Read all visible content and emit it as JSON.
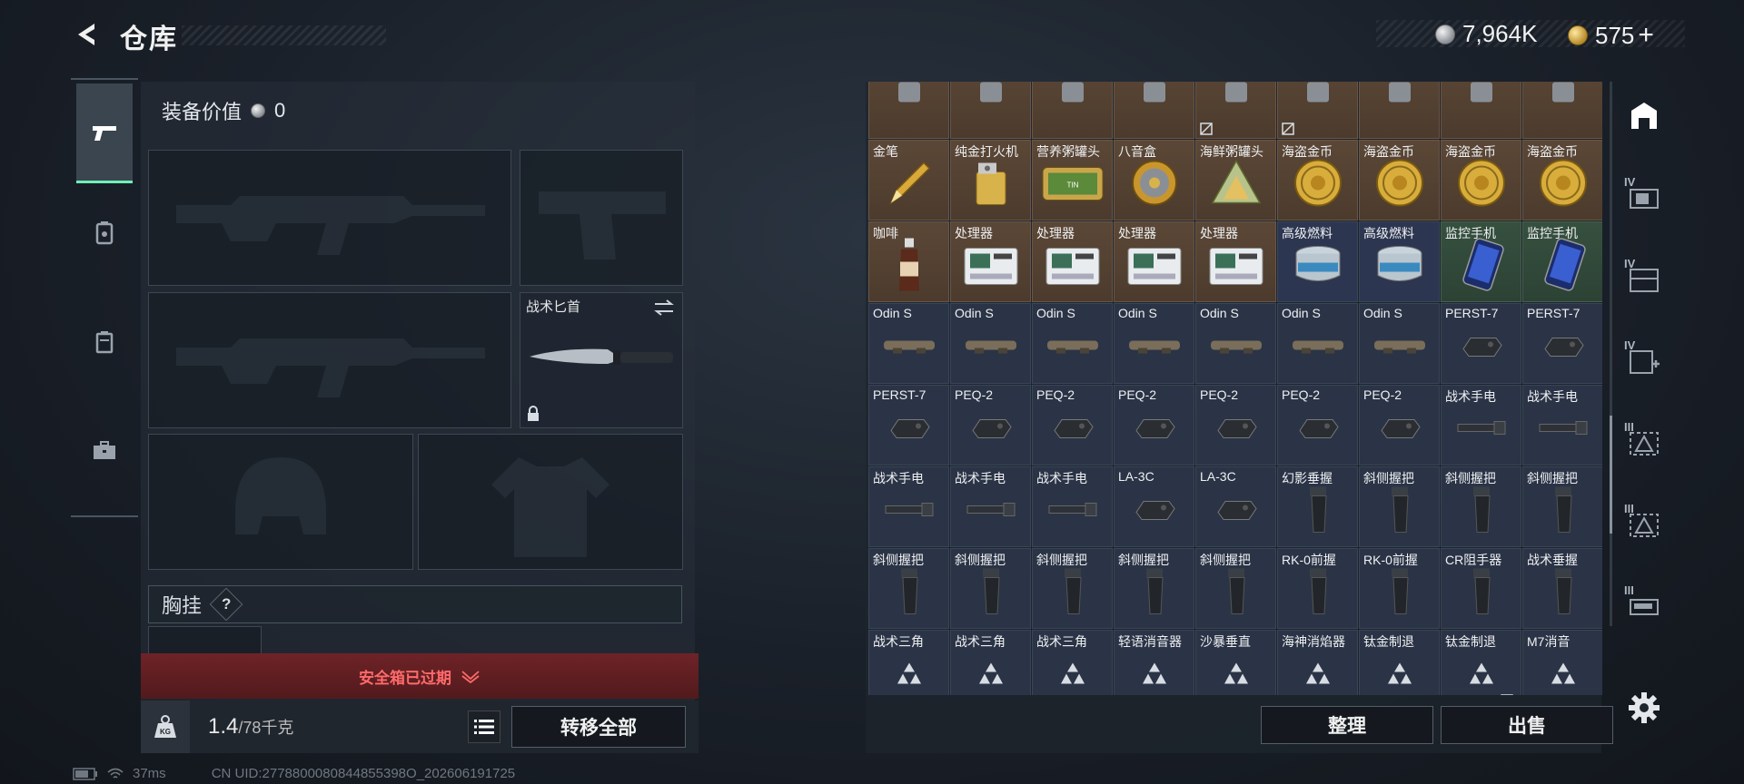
{
  "header": {
    "title": "仓库",
    "currencies": [
      {
        "type": "silver",
        "value": "7,964K"
      },
      {
        "type": "gold",
        "value": "575"
      }
    ],
    "gold_add_label": "+"
  },
  "left_nav": [
    "weapon-tab",
    "armor-tab",
    "backpack-tab",
    "case-tab"
  ],
  "equipment": {
    "value_label": "装备价值",
    "value": "0",
    "melee_label": "战术匕首",
    "vest_label": "胸挂",
    "help_glyph": "?",
    "safebox_expired": "安全箱已过期",
    "weight_current": "1.4",
    "weight_max": "/78千克",
    "kg_label": "KG",
    "transfer_all": "转移全部"
  },
  "status": {
    "ping": "37ms",
    "uid": "CN UID:2778800080844855398O_202606191725"
  },
  "items": [
    {
      "name": "金笔",
      "bg": "brown",
      "icon": "pen"
    },
    {
      "name": "纯金打火机",
      "bg": "brown",
      "icon": "lighter"
    },
    {
      "name": "营养粥罐头",
      "bg": "brown",
      "icon": "tin"
    },
    {
      "name": "八音盒",
      "bg": "brown",
      "icon": "musicbox"
    },
    {
      "name": "海鲜粥罐头",
      "bg": "brown",
      "icon": "pyramid-can"
    },
    {
      "name": "海盗金币",
      "bg": "brown",
      "icon": "coin"
    },
    {
      "name": "海盗金币",
      "bg": "brown",
      "icon": "coin"
    },
    {
      "name": "海盗金币",
      "bg": "brown",
      "icon": "coin"
    },
    {
      "name": "海盗金币",
      "bg": "brown",
      "icon": "coin"
    },
    {
      "name": "咖啡",
      "bg": "brown",
      "icon": "bottle"
    },
    {
      "name": "处理器",
      "bg": "brown",
      "icon": "processor"
    },
    {
      "name": "处理器",
      "bg": "brown",
      "icon": "processor"
    },
    {
      "name": "处理器",
      "bg": "brown",
      "icon": "processor"
    },
    {
      "name": "处理器",
      "bg": "brown",
      "icon": "processor"
    },
    {
      "name": "高级燃料",
      "bg": "blue",
      "icon": "fuel"
    },
    {
      "name": "高级燃料",
      "bg": "blue",
      "icon": "fuel"
    },
    {
      "name": "监控手机",
      "bg": "green",
      "icon": "phone"
    },
    {
      "name": "监控手机",
      "bg": "green",
      "icon": "phone"
    },
    {
      "name": "Odin S",
      "bg": "",
      "icon": "scope"
    },
    {
      "name": "Odin S",
      "bg": "",
      "icon": "scope"
    },
    {
      "name": "Odin S",
      "bg": "",
      "icon": "scope"
    },
    {
      "name": "Odin S",
      "bg": "",
      "icon": "scope"
    },
    {
      "name": "Odin S",
      "bg": "",
      "icon": "scope"
    },
    {
      "name": "Odin S",
      "bg": "",
      "icon": "scope"
    },
    {
      "name": "Odin S",
      "bg": "",
      "icon": "scope"
    },
    {
      "name": "PERST-7",
      "bg": "",
      "icon": "laser"
    },
    {
      "name": "PERST-7",
      "bg": "",
      "icon": "laser"
    },
    {
      "name": "PERST-7",
      "bg": "",
      "icon": "laser"
    },
    {
      "name": "PEQ-2",
      "bg": "",
      "icon": "laser"
    },
    {
      "name": "PEQ-2",
      "bg": "",
      "icon": "laser"
    },
    {
      "name": "PEQ-2",
      "bg": "",
      "icon": "laser"
    },
    {
      "name": "PEQ-2",
      "bg": "",
      "icon": "laser"
    },
    {
      "name": "PEQ-2",
      "bg": "",
      "icon": "laser"
    },
    {
      "name": "PEQ-2",
      "bg": "",
      "icon": "laser"
    },
    {
      "name": "战术手电",
      "bg": "",
      "icon": "flashlight"
    },
    {
      "name": "战术手电",
      "bg": "",
      "icon": "flashlight"
    },
    {
      "name": "战术手电",
      "bg": "",
      "icon": "flashlight"
    },
    {
      "name": "战术手电",
      "bg": "",
      "icon": "flashlight"
    },
    {
      "name": "战术手电",
      "bg": "",
      "icon": "flashlight"
    },
    {
      "name": "LA-3C",
      "bg": "",
      "icon": "laser"
    },
    {
      "name": "LA-3C",
      "bg": "",
      "icon": "laser"
    },
    {
      "name": "幻影垂握",
      "bg": "",
      "icon": "grip"
    },
    {
      "name": "斜侧握把",
      "bg": "",
      "icon": "grip"
    },
    {
      "name": "斜侧握把",
      "bg": "",
      "icon": "grip"
    },
    {
      "name": "斜侧握把",
      "bg": "",
      "icon": "grip"
    },
    {
      "name": "斜侧握把",
      "bg": "",
      "icon": "grip"
    },
    {
      "name": "斜侧握把",
      "bg": "",
      "icon": "grip"
    },
    {
      "name": "斜侧握把",
      "bg": "",
      "icon": "grip"
    },
    {
      "name": "斜侧握把",
      "bg": "",
      "icon": "grip"
    },
    {
      "name": "斜侧握把",
      "bg": "",
      "icon": "grip"
    },
    {
      "name": "RK-0前握",
      "bg": "",
      "icon": "grip"
    },
    {
      "name": "RK-0前握",
      "bg": "",
      "icon": "grip"
    },
    {
      "name": "CR阻手器",
      "bg": "",
      "icon": "grip"
    },
    {
      "name": "战术垂握",
      "bg": "",
      "icon": "grip"
    },
    {
      "name": "战术三角",
      "bg": "",
      "icon": "triangle"
    },
    {
      "name": "战术三角",
      "bg": "",
      "icon": "triangle"
    },
    {
      "name": "战术三角",
      "bg": "",
      "icon": "triangle"
    },
    {
      "name": "轻语消音器",
      "bg": "",
      "icon": "triangle"
    },
    {
      "name": "沙暴垂直",
      "bg": "",
      "icon": "triangle"
    },
    {
      "name": "海神消焰器",
      "bg": "",
      "icon": "triangle"
    },
    {
      "name": "钛金制退",
      "bg": "",
      "icon": "triangle"
    },
    {
      "name": "钛金制退",
      "bg": "",
      "icon": "triangle"
    },
    {
      "name": "M7消音",
      "bg": "",
      "icon": "triangle"
    }
  ],
  "actions": {
    "sort": "整理",
    "sell": "出售"
  },
  "rail": [
    {
      "lvl": "",
      "icon": "bunker"
    },
    {
      "lvl": "IV",
      "icon": "workbench"
    },
    {
      "lvl": "IV",
      "icon": "storage"
    },
    {
      "lvl": "IV",
      "icon": "medical"
    },
    {
      "lvl": "III",
      "icon": "armor-bench"
    },
    {
      "lvl": "III",
      "icon": "armor-bench"
    },
    {
      "lvl": "III",
      "icon": "gun-bench"
    }
  ],
  "colors": {
    "accent": "#6ff0b8",
    "expired_bg": "#6e2327",
    "expired_text": "#ff6a6a",
    "item_blue": "#2b3446",
    "item_brown": "#5b4736",
    "item_green": "#36503f"
  }
}
